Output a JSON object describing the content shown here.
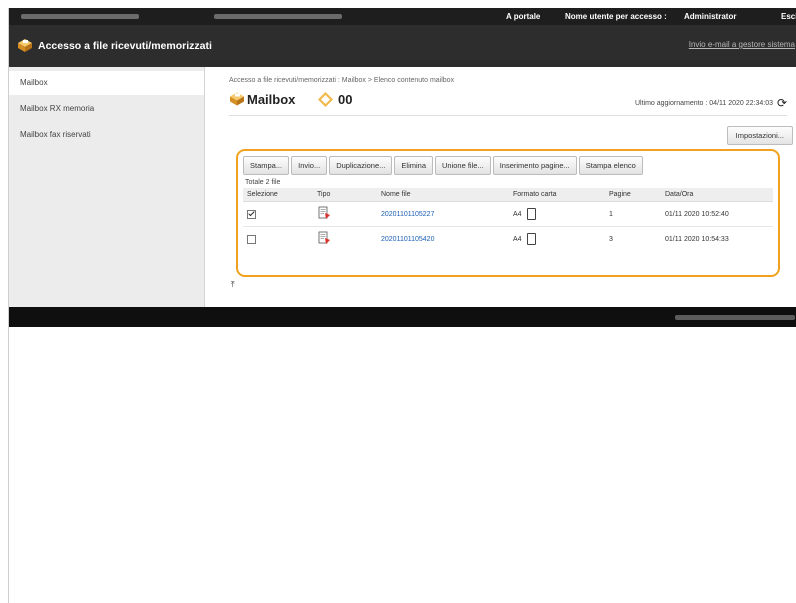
{
  "topbar": {
    "portal_link": "A portale",
    "user_label": "Nome utente per accesso :",
    "user_name": "Administrator",
    "logout_label": "Esci"
  },
  "header": {
    "title": "Accesso a file ricevuti/memorizzati",
    "email_link": "Invio e-mail a gestore sistema"
  },
  "sidebar": {
    "items": [
      {
        "label": "Mailbox",
        "active": true
      },
      {
        "label": "Mailbox RX memoria",
        "active": false
      },
      {
        "label": "Mailbox fax riservati",
        "active": false
      }
    ]
  },
  "main": {
    "breadcrumb": "Accesso a file ricevuti/memorizzati : Mailbox > Elenco contenuto mailbox",
    "title": "Mailbox",
    "mailbox_number": "00",
    "last_update": "Ultimo aggiornamento : 04/11 2020 22:34:03",
    "settings_button": "Impostazioni...",
    "toolbar": {
      "print": "Stampa...",
      "send": "Invio...",
      "duplicate": "Duplicazione...",
      "delete": "Elimina",
      "merge": "Unione file...",
      "insert_pages": "Inserimento pagine...",
      "print_list": "Stampa elenco"
    },
    "total": "Totale 2 file",
    "columns": [
      "Selezione",
      "Tipo",
      "Nome file",
      "Formato carta",
      "Pagine",
      "Data/Ora"
    ],
    "rows": [
      {
        "selected": true,
        "type_icon": "document-icon",
        "name": "20201101105227",
        "paper": "A4",
        "pages": "1",
        "date": "01/11 2020 10:52:40"
      },
      {
        "selected": false,
        "type_icon": "document-icon",
        "name": "20201101105420",
        "paper": "A4",
        "pages": "3",
        "date": "01/11 2020 10:54:33"
      }
    ]
  },
  "colors": {
    "highlight": "#f0a21e",
    "link": "#1a5fb4",
    "topbar": "#1e1e1e",
    "titlebar": "#2d2d2d"
  }
}
